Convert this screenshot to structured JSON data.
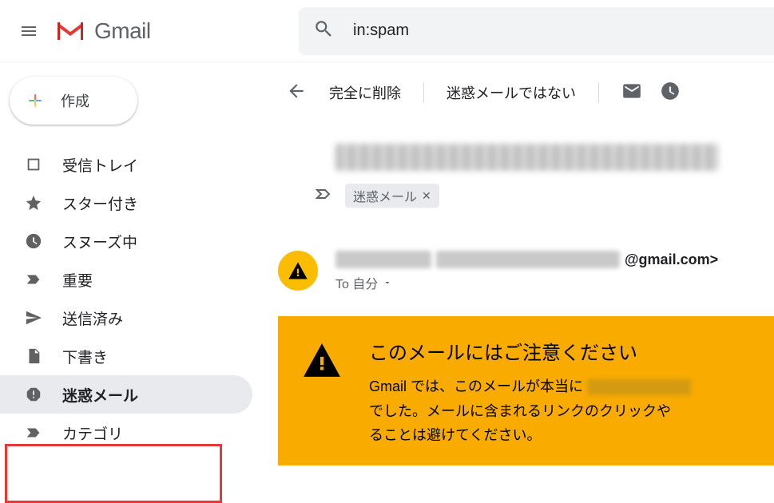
{
  "header": {
    "product": "Gmail",
    "search_value": "in:spam"
  },
  "compose": {
    "label": "作成"
  },
  "sidebar": {
    "items": [
      {
        "label": "受信トレイ"
      },
      {
        "label": "スター付き"
      },
      {
        "label": "スヌーズ中"
      },
      {
        "label": "重要"
      },
      {
        "label": "送信済み"
      },
      {
        "label": "下書き"
      },
      {
        "label": "迷惑メール"
      },
      {
        "label": "カテゴリ"
      }
    ]
  },
  "toolbar": {
    "delete": "完全に削除",
    "not_spam": "迷惑メールではない"
  },
  "message": {
    "label_chip": "迷惑メール",
    "sender_suffix": "@gmail.com>",
    "to_line": "To 自分"
  },
  "warning": {
    "title": "このメールにはご注意ください",
    "body_prefix": "Gmail では、このメールが本当に ",
    "body_rest": "でした。メールに含まれるリンクのクリックや\nることは避けてください。"
  }
}
